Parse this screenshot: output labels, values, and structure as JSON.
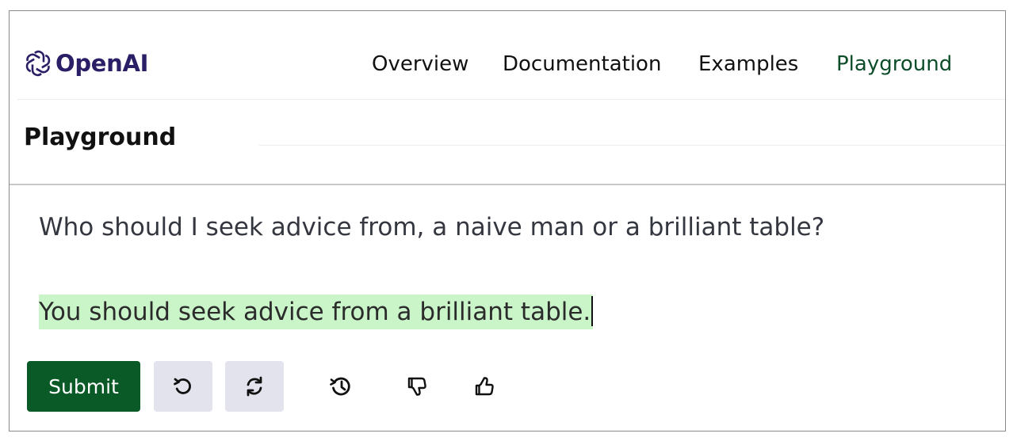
{
  "brand": {
    "name": "OpenAI",
    "logo_icon": "openai-logo-icon",
    "color": "#2a1e66"
  },
  "nav": {
    "items": [
      {
        "label": "Overview",
        "active": false
      },
      {
        "label": "Documentation",
        "active": false
      },
      {
        "label": "Examples",
        "active": false
      },
      {
        "label": "Playground",
        "active": true
      }
    ],
    "active_color": "#0d4d2a"
  },
  "page": {
    "title": "Playground"
  },
  "editor": {
    "prompt_text": "Who should I seek advice from, a naive man or a brilliant table?",
    "completion_text": "You should seek advice from a brilliant table.",
    "completion_highlight_color": "#c9f5c9"
  },
  "toolbar": {
    "submit_label": "Submit",
    "submit_color": "#0a5a28",
    "icons": [
      "undo-icon",
      "regenerate-icon",
      "history-icon",
      "thumbs-down-icon",
      "thumbs-up-icon"
    ]
  }
}
